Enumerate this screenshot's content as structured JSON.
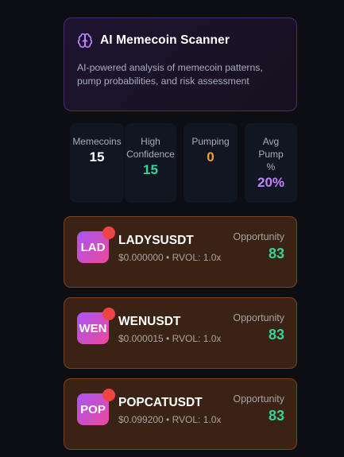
{
  "header": {
    "title": "AI Memecoin Scanner",
    "description": "AI-powered analysis of memecoin patterns, pump probabilities, and risk assessment",
    "icon": "brain-icon",
    "accent": "#c084fc"
  },
  "stats": [
    {
      "label": "Memecoins",
      "value": "15",
      "color": "#ffffff"
    },
    {
      "label": "High Confidence",
      "value": "15",
      "color": "#34d399"
    },
    {
      "label": "Pumping",
      "value": "0",
      "color": "#f59e2b"
    },
    {
      "label": "Avg Pump %",
      "value": "20%",
      "color": "#c084fc"
    }
  ],
  "coins": [
    {
      "abbr": "LAD",
      "symbol": "LADYSUSDT",
      "meta": "$0.000000 • RVOL: 1.0x",
      "opportunity_label": "Opportunity",
      "opportunity": "83"
    },
    {
      "abbr": "WEN",
      "symbol": "WENUSDT",
      "meta": "$0.000015 • RVOL: 1.0x",
      "opportunity_label": "Opportunity",
      "opportunity": "83"
    },
    {
      "abbr": "POP",
      "symbol": "POPCATUSDT",
      "meta": "$0.099200 • RVOL: 1.0x",
      "opportunity_label": "Opportunity",
      "opportunity": "83"
    }
  ]
}
